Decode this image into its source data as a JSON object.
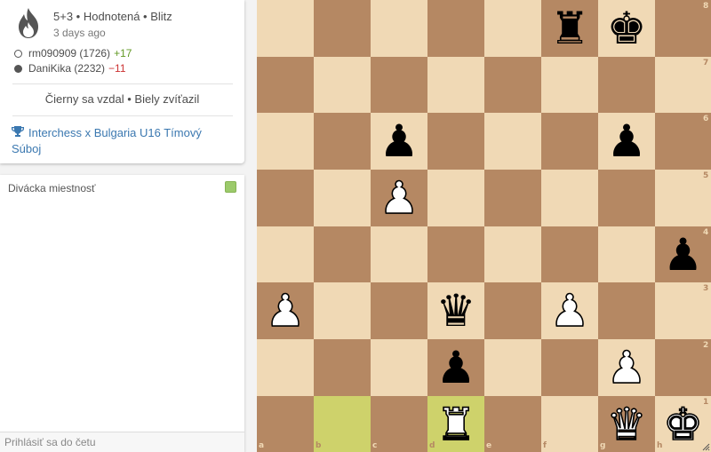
{
  "game": {
    "title": "5+3 • Hodnotená • Blitz",
    "time_ago": "3 days ago",
    "players": [
      {
        "name": "rm090909 (1726)",
        "diff": "+17",
        "color": "white"
      },
      {
        "name": "DaniKika (2232)",
        "diff": "−11",
        "color": "black"
      }
    ],
    "result": "Čierny sa vzdal • Biely zvíťazil",
    "tournament": "Interchess x Bulgaria U16 Tímový Súboj",
    "icon": "fire-icon"
  },
  "chat": {
    "title": "Divácka miestnosť",
    "placeholder": "Prihlásiť sa do četu",
    "toggle_color": "#9cca6b"
  },
  "board": {
    "files": [
      "a",
      "b",
      "c",
      "d",
      "e",
      "f",
      "g",
      "h"
    ],
    "ranks": [
      "8",
      "7",
      "6",
      "5",
      "4",
      "3",
      "2",
      "1"
    ],
    "light_color": "#f0d9b5",
    "dark_color": "#b58863",
    "highlight_squares": [
      "b1",
      "d1"
    ],
    "pieces": [
      {
        "square": "f8",
        "type": "rook",
        "color": "black",
        "glyph": "♜"
      },
      {
        "square": "g8",
        "type": "king",
        "color": "black",
        "glyph": "♚"
      },
      {
        "square": "c6",
        "type": "pawn",
        "color": "black",
        "glyph": "♟"
      },
      {
        "square": "g6",
        "type": "pawn",
        "color": "black",
        "glyph": "♟"
      },
      {
        "square": "c5",
        "type": "pawn",
        "color": "white",
        "glyph": "♟"
      },
      {
        "square": "h4",
        "type": "pawn",
        "color": "black",
        "glyph": "♟"
      },
      {
        "square": "a3",
        "type": "pawn",
        "color": "white",
        "glyph": "♟"
      },
      {
        "square": "d3",
        "type": "queen",
        "color": "black",
        "glyph": "♛"
      },
      {
        "square": "f3",
        "type": "pawn",
        "color": "white",
        "glyph": "♟"
      },
      {
        "square": "d2",
        "type": "pawn",
        "color": "black",
        "glyph": "♟"
      },
      {
        "square": "g2",
        "type": "pawn",
        "color": "white",
        "glyph": "♟"
      },
      {
        "square": "d1",
        "type": "rook",
        "color": "white",
        "glyph": "♜"
      },
      {
        "square": "g1",
        "type": "queen",
        "color": "white",
        "glyph": "♛"
      },
      {
        "square": "h1",
        "type": "king",
        "color": "white",
        "glyph": "♚"
      }
    ]
  }
}
